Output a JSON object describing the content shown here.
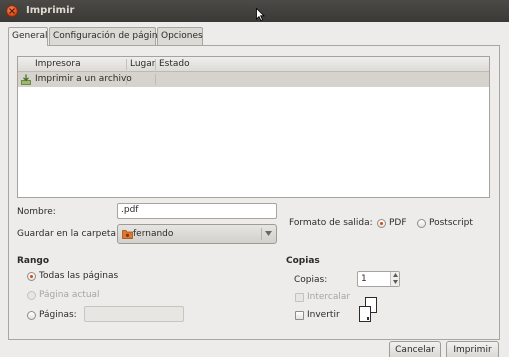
{
  "window": {
    "title": "Imprimir",
    "close_icon": "close-icon"
  },
  "tabs": [
    {
      "label": "General",
      "active": true
    },
    {
      "label": "Configuración de página",
      "active": false
    },
    {
      "label": "Opciones",
      "active": false
    }
  ],
  "printer_list": {
    "columns": [
      "Impresora",
      "Lugar",
      "Estado"
    ],
    "rows": [
      {
        "printer": "Imprimir a un archivo",
        "location": "",
        "status": ""
      }
    ]
  },
  "name_field": {
    "label": "Nombre:",
    "value": ".pdf"
  },
  "folder_field": {
    "label": "Guardar en la carpeta:",
    "value": "fernando"
  },
  "output_format": {
    "label": "Formato de salida:",
    "options": [
      "PDF",
      "Postscript"
    ],
    "selected": "PDF"
  },
  "range": {
    "title": "Rango",
    "all_pages": "Todas las páginas",
    "current_page": "Página actual",
    "pages": "Páginas:",
    "pages_value": "",
    "selected": "all_pages"
  },
  "copies": {
    "title": "Copias",
    "label": "Copias:",
    "value": "1",
    "collate": "Intercalar",
    "reverse": "Invertir"
  },
  "buttons": {
    "cancel": "Cancelar",
    "print": "Imprimir"
  },
  "colors": {
    "accent": "#dd4814",
    "selection": "#d6d3cc",
    "titlebar": "#3c3b37"
  }
}
